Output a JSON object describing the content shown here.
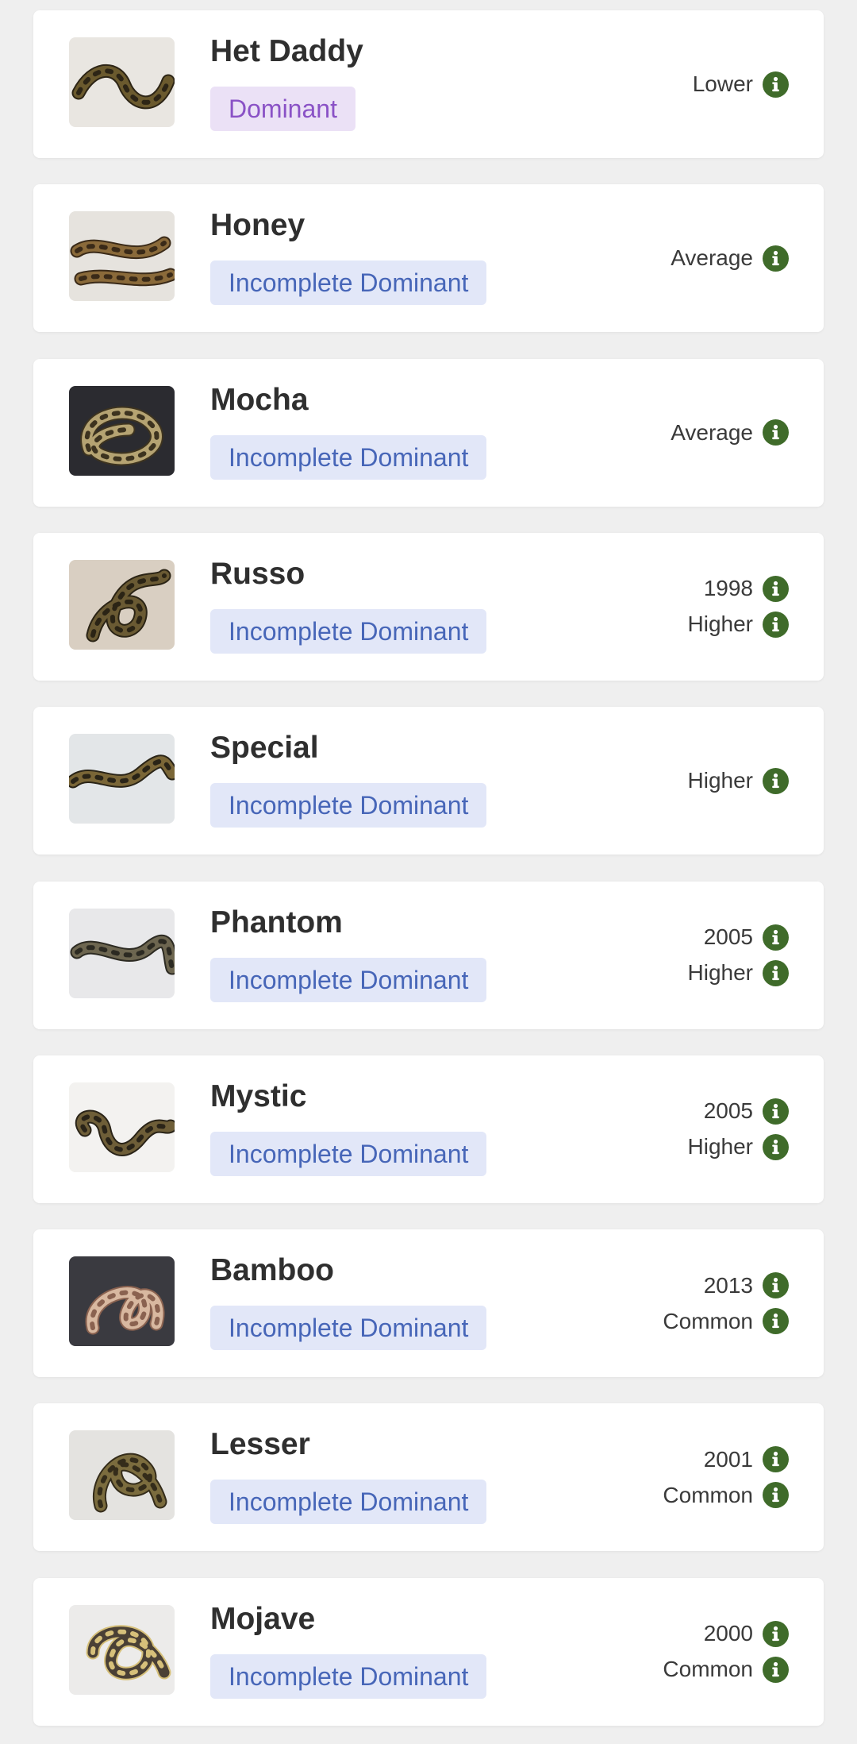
{
  "colors": {
    "page_bg": "#efefef",
    "card_bg": "#ffffff",
    "name_text": "#2f2f2f",
    "meta_text": "#3a3a3a",
    "info_icon": "#3f6b2a",
    "dominant_badge_bg": "#ebe1f6",
    "dominant_badge_text": "#8a52c6",
    "incomplete_badge_bg": "#e2e7f8",
    "incomplete_badge_text": "#4766b8"
  },
  "morphs": [
    {
      "name": "Het Daddy",
      "inheritance": "Dominant",
      "badge_style": "dominant",
      "year": null,
      "rarity": "Lower",
      "image_icon": "ball-python-photo",
      "photo": {
        "bg": "#e9e6e1",
        "body": "#6b5a2e",
        "spot": "#2d2516"
      }
    },
    {
      "name": "Honey",
      "inheritance": "Incomplete Dominant",
      "badge_style": "incomplete",
      "year": null,
      "rarity": "Average",
      "image_icon": "ball-python-photo",
      "photo": {
        "bg": "#e6e3de",
        "body": "#8a6a3a",
        "spot": "#3a2a18"
      }
    },
    {
      "name": "Mocha",
      "inheritance": "Incomplete Dominant",
      "badge_style": "incomplete",
      "year": null,
      "rarity": "Average",
      "image_icon": "ball-python-photo",
      "photo": {
        "bg": "#2b2b30",
        "body": "#b5a372",
        "spot": "#3d331f"
      }
    },
    {
      "name": "Russo",
      "inheritance": "Incomplete Dominant",
      "badge_style": "incomplete",
      "year": "1998",
      "rarity": "Higher",
      "image_icon": "ball-python-photo",
      "photo": {
        "bg": "#d9cfc2",
        "body": "#6a5a33",
        "spot": "#2b2415"
      }
    },
    {
      "name": "Special",
      "inheritance": "Incomplete Dominant",
      "badge_style": "incomplete",
      "year": null,
      "rarity": "Higher",
      "image_icon": "ball-python-photo",
      "photo": {
        "bg": "#e3e6e8",
        "body": "#7a6637",
        "spot": "#2a2417"
      }
    },
    {
      "name": "Phantom",
      "inheritance": "Incomplete Dominant",
      "badge_style": "incomplete",
      "year": "2005",
      "rarity": "Higher",
      "image_icon": "ball-python-photo",
      "photo": {
        "bg": "#e8e8ea",
        "body": "#6d6650",
        "spot": "#2c2a22"
      }
    },
    {
      "name": "Mystic",
      "inheritance": "Incomplete Dominant",
      "badge_style": "incomplete",
      "year": "2005",
      "rarity": "Higher",
      "image_icon": "ball-python-photo",
      "photo": {
        "bg": "#f3f2f0",
        "body": "#6e5e38",
        "spot": "#2a2418"
      }
    },
    {
      "name": "Bamboo",
      "inheritance": "Incomplete Dominant",
      "badge_style": "incomplete",
      "year": "2013",
      "rarity": "Common",
      "image_icon": "ball-python-photo",
      "photo": {
        "bg": "#3a3a40",
        "body": "#d8b8a0",
        "spot": "#8a6250"
      }
    },
    {
      "name": "Lesser",
      "inheritance": "Incomplete Dominant",
      "badge_style": "incomplete",
      "year": "2001",
      "rarity": "Common",
      "image_icon": "ball-python-photo",
      "photo": {
        "bg": "#e4e3e0",
        "body": "#7b6c3e",
        "spot": "#342c1a"
      }
    },
    {
      "name": "Mojave",
      "inheritance": "Incomplete Dominant",
      "badge_style": "incomplete",
      "year": "2000",
      "rarity": "Common",
      "image_icon": "ball-python-photo",
      "photo": {
        "bg": "#ecebea",
        "body": "#4a4035",
        "spot": "#d6c07a"
      }
    }
  ]
}
